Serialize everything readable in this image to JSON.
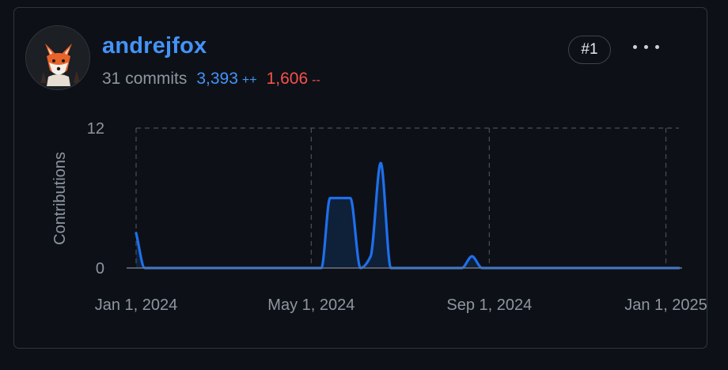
{
  "contributor": {
    "username": "andrejfox",
    "commits": "31 commits",
    "additions": "3,393",
    "additions_suffix": "++",
    "deletions": "1,606",
    "deletions_suffix": "--",
    "rank": "#1",
    "avatar_icon": "fox-avatar-icon",
    "more_icon": "kebab-menu-icon"
  },
  "colors": {
    "accent": "#4493f8",
    "additions": "#4493f8",
    "deletions": "#f85149",
    "line": "#1f6feb",
    "grid": "#484f58",
    "text_muted": "#8d96a0"
  },
  "chart_data": {
    "type": "area",
    "ylabel": "Contributions",
    "xlabel": "",
    "ylim": [
      0,
      12
    ],
    "y_ticks": [
      "0",
      "12"
    ],
    "x_ticks": [
      "Jan 1, 2024",
      "May 1, 2024",
      "Sep 1, 2024",
      "Jan 1, 2025"
    ],
    "x_tick_dates": [
      "2024-01-01",
      "2024-05-01",
      "2024-09-01",
      "2025-01-01"
    ],
    "x_range": [
      "2024-01-01",
      "2025-01-10"
    ],
    "grid": true,
    "series": [
      {
        "x": [
          "2024-01-01",
          "2024-01-07",
          "2024-05-01",
          "2024-05-08",
          "2024-05-14",
          "2024-05-21",
          "2024-05-28",
          "2024-06-04",
          "2024-06-11",
          "2024-06-18",
          "2024-06-25",
          "2024-07-02",
          "2024-08-13",
          "2024-08-20",
          "2024-08-27",
          "2025-01-10"
        ],
        "values": [
          3,
          0,
          0,
          0,
          6,
          6,
          6,
          0,
          1,
          9,
          0,
          0,
          0,
          1,
          0,
          0
        ]
      }
    ]
  }
}
